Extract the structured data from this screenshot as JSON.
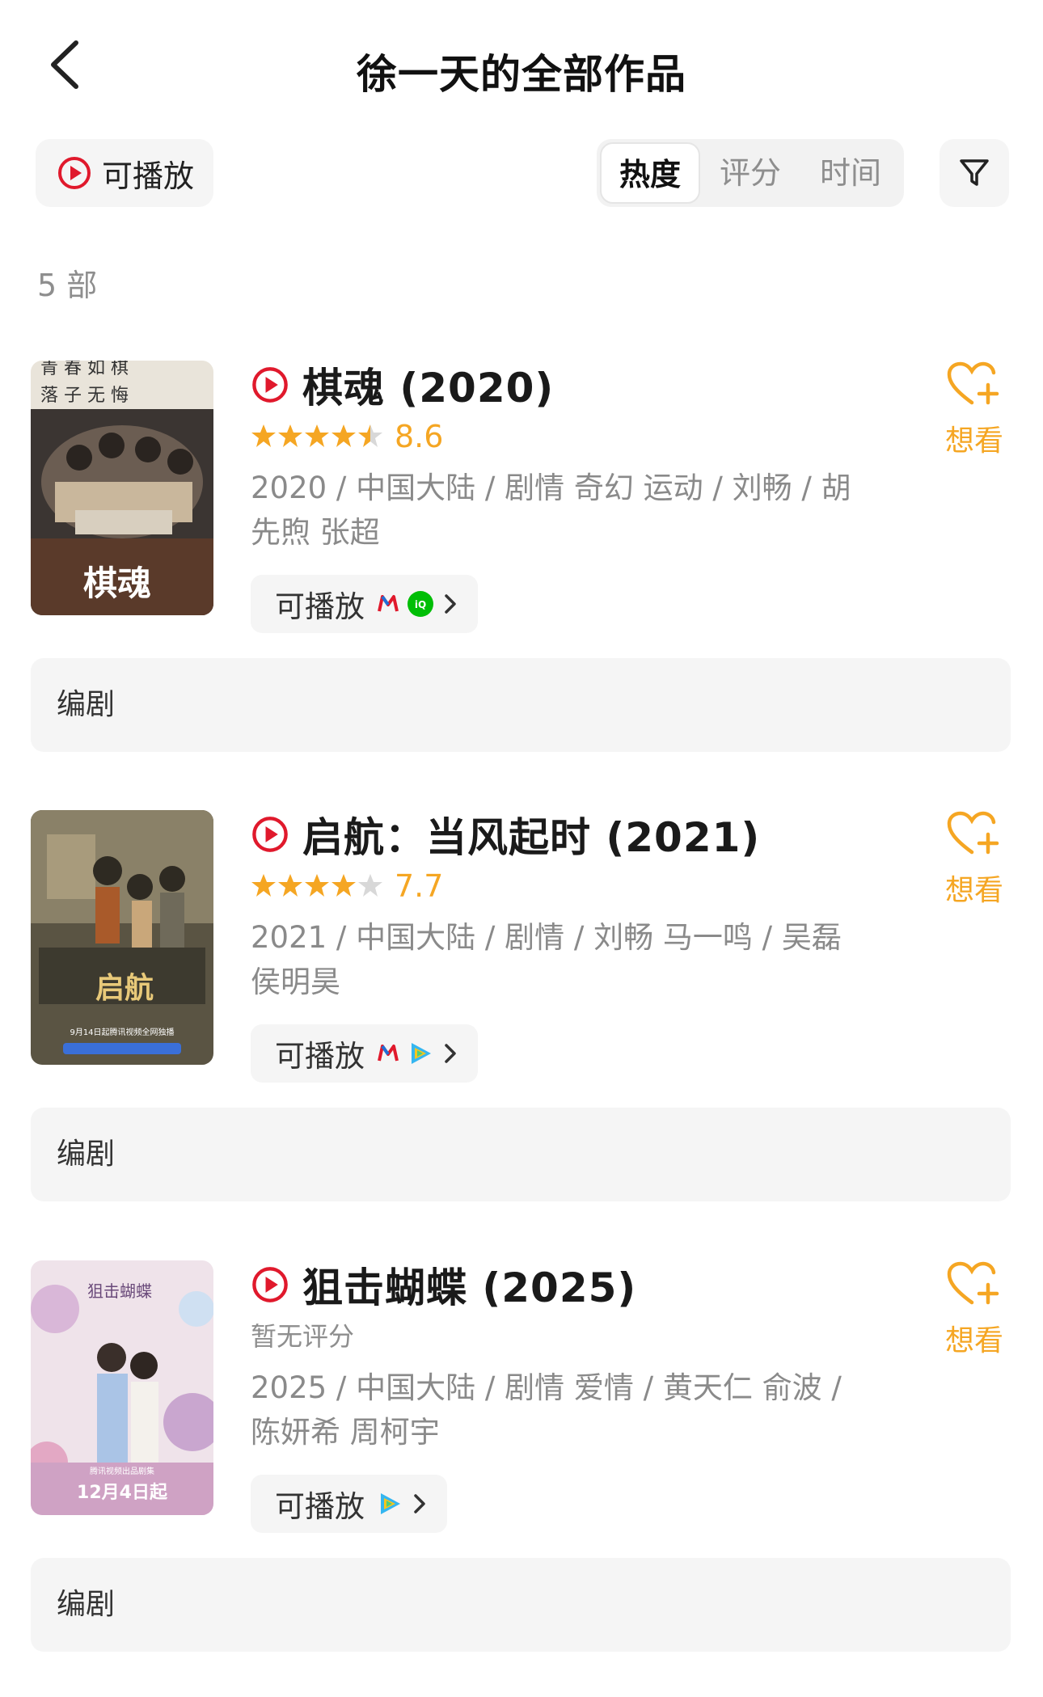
{
  "header": {
    "title": "徐一天的全部作品"
  },
  "filters": {
    "playable_label": "可播放",
    "sort_options": [
      "热度",
      "评分",
      "时间"
    ],
    "active_sort": "热度"
  },
  "count_text": "5 部",
  "colors": {
    "accent": "#f5a623",
    "play_red": "#e0192c",
    "star_empty": "#d8d8d8"
  },
  "movies": [
    {
      "title": "棋魂 (2020)",
      "rating_stars": 4.5,
      "score": "8.6",
      "meta": "2020 / 中国大陆 / 剧情 奇幻 运动 / 刘畅 / 胡先煦 张超",
      "play_label": "可播放",
      "sources": [
        "mgtv-icon",
        "iqiyi-icon"
      ],
      "want_label": "想看",
      "role": "编剧",
      "poster_text": "棋魂",
      "poster_top_text": [
        "青",
        "春",
        "如",
        "棋",
        "落",
        "子",
        "无",
        "悔"
      ]
    },
    {
      "title": "启航：当风起时 (2021)",
      "rating_stars": 4,
      "score": "7.7",
      "meta": "2021 / 中国大陆 / 剧情 / 刘畅 马一鸣 / 吴磊 侯明昊",
      "play_label": "可播放",
      "sources": [
        "mgtv-icon",
        "tencent-video-icon"
      ],
      "want_label": "想看",
      "role": "编剧",
      "poster_text": "启航",
      "poster_caption": "9月14日起腾讯视频全网独播"
    },
    {
      "title": "狙击蝴蝶 (2025)",
      "no_rating": "暂无评分",
      "meta": "2025 / 中国大陆 / 剧情 爱情 / 黄天仁 俞波 / 陈妍希 周柯宇",
      "play_label": "可播放",
      "sources": [
        "tencent-video-icon"
      ],
      "want_label": "想看",
      "role": "编剧",
      "poster_text": "狙击蝴蝶",
      "poster_caption": "腾讯视频出品剧集",
      "poster_date": "12月4日起"
    }
  ]
}
